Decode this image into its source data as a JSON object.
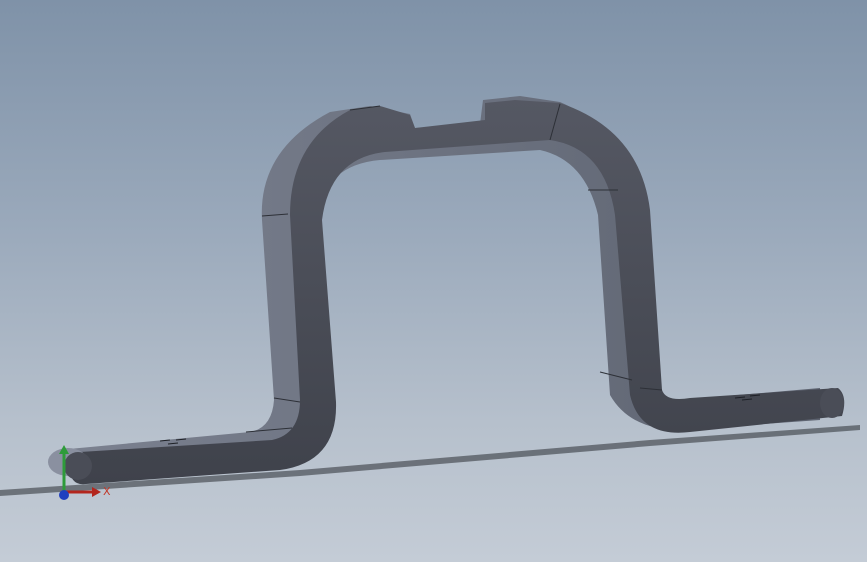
{
  "viewport": {
    "background_top": "#7f92a8",
    "background_bottom": "#c4ccd6"
  },
  "model": {
    "part_color_top": "#4a4d57",
    "part_color_side": "#6e7482",
    "part_color_dark": "#3b3e47",
    "shadow_color": "#2a2d33"
  },
  "triad": {
    "x_label": "X",
    "x_color": "#b3261e",
    "y_color": "#2e9b3a",
    "z_color": "#1f3fbf"
  }
}
